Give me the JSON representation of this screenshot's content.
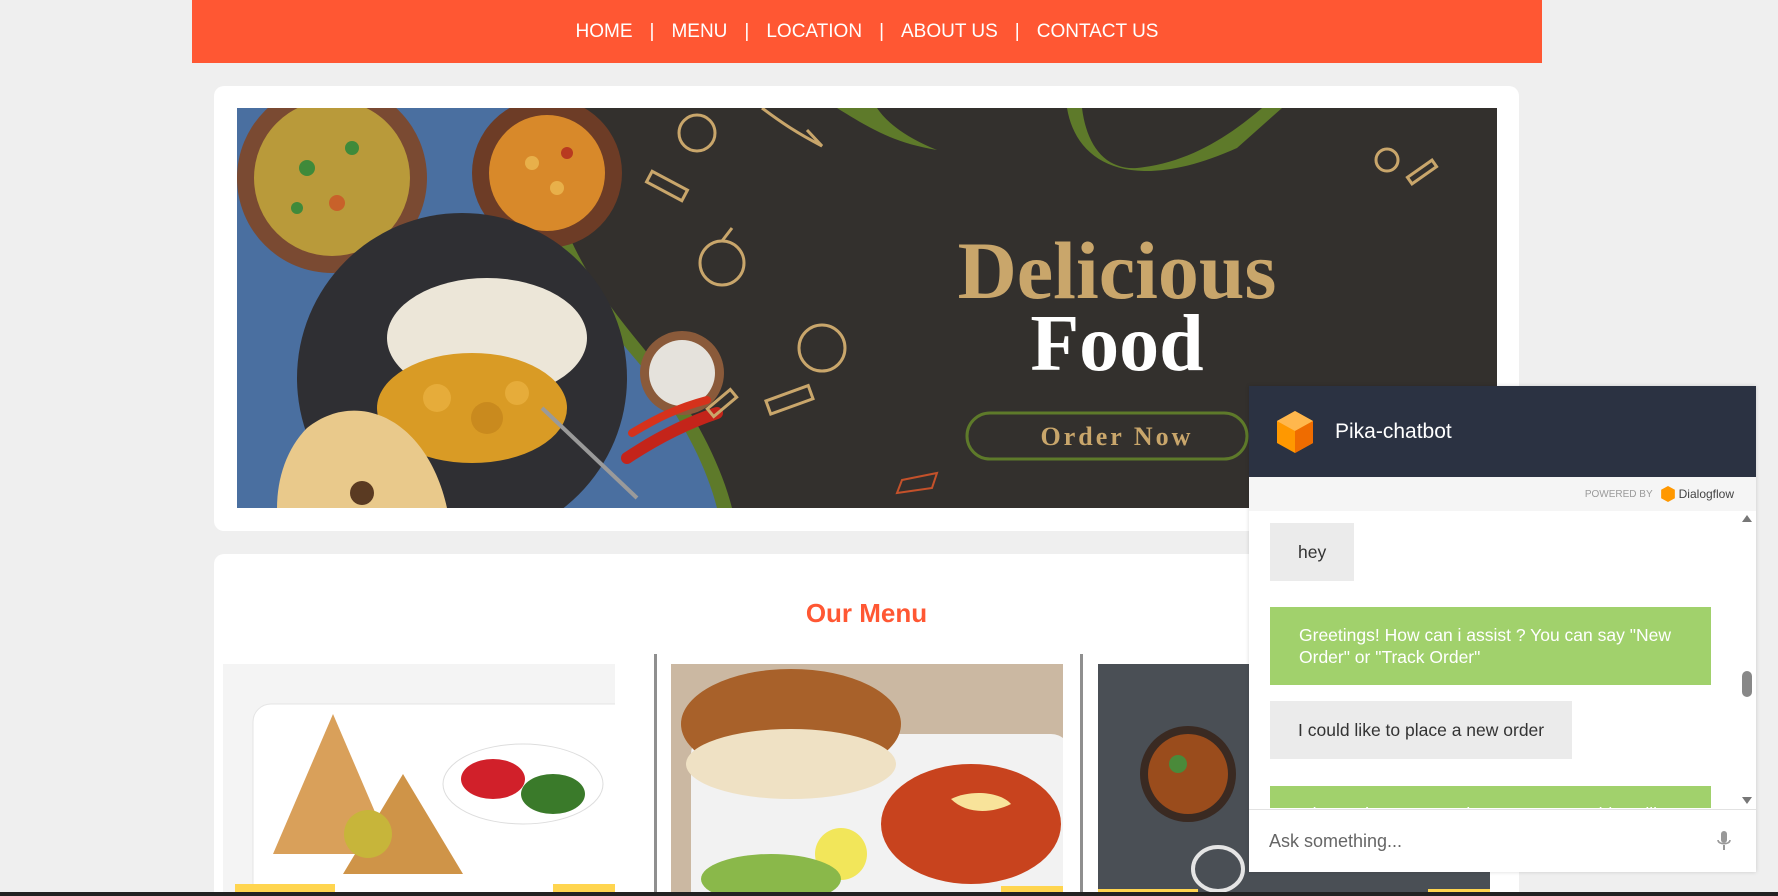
{
  "nav": {
    "items": [
      "HOME",
      "MENU",
      "LOCATION",
      "ABOUT US",
      "CONTACT US"
    ],
    "separator": "|"
  },
  "banner": {
    "title_line1": "Delicious",
    "title_line2": "Food",
    "cta": "Order Now"
  },
  "menu": {
    "title": "Our Menu"
  },
  "chatbot": {
    "title": "Pika-chatbot",
    "powered_by": "POWERED BY",
    "provider": "Dialogflow",
    "messages": [
      {
        "from": "user",
        "text": "hey"
      },
      {
        "from": "bot",
        "text": "Greetings! How can i assist ? You can say \"New Order\" or \"Track Order\""
      },
      {
        "from": "user",
        "text": "I could like to place a new order"
      },
      {
        "from": "bot",
        "text": "Ok, starting a new order. You can say things like"
      }
    ],
    "input_placeholder": "Ask something..."
  },
  "colors": {
    "brand": "#ff5733",
    "chat_header": "#2b3242",
    "bot_bubble": "#a1d16c",
    "banner_gold": "#c9a66b"
  }
}
